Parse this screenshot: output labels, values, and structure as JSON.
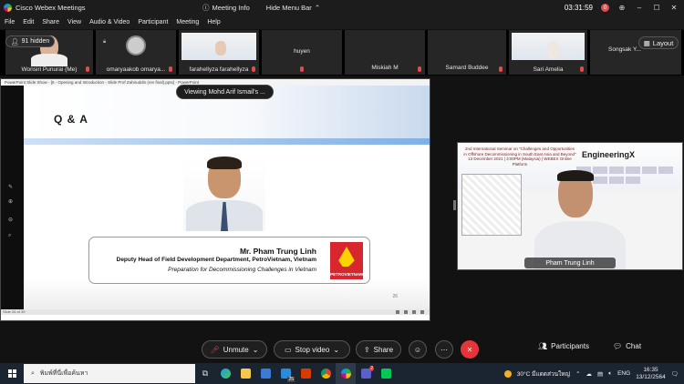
{
  "app": {
    "title": "Cisco Webex Meetings",
    "meeting_info": "Meeting Info",
    "hide_menu": "Hide Menu Bar",
    "timer": "03:31:59",
    "timer_badge": "0"
  },
  "menu": [
    "File",
    "Edit",
    "Share",
    "View",
    "Audio & Video",
    "Participant",
    "Meeting",
    "Help"
  ],
  "thumbnails": {
    "hidden_label": "91 hidden",
    "participants": [
      {
        "name": "Wonsiri Punurai (Me)"
      },
      {
        "name": "omaryaakob omarya..."
      },
      {
        "name": "farahellyza farahellyza"
      },
      {
        "name": "huyen"
      },
      {
        "name": "Miskiah M"
      },
      {
        "name": "Samard Buddee"
      },
      {
        "name": "Sari Amelia"
      },
      {
        "name": "Songsak Y..."
      }
    ],
    "layout_label": "Layout"
  },
  "share": {
    "viewing_label": "Viewing Mohd Arif Ismail's ...",
    "window_title": "PowerPoint Slide Show - [6 - Opening and Introduction - Slide Prof Zahiruddin (rev final).pptx] - PowerPoint",
    "slide": {
      "title": "Q & A",
      "speaker_name": "Mr. Pham Trung Linh",
      "role": "Deputy Head of Field Development Department, PetroVietnam, Vietnam",
      "topic": "Preparation for Decommissioning Challenges in Vietnam",
      "logo_text": "PETROVIETNAM",
      "page": "26"
    },
    "status_text": "Slide 26 of 39"
  },
  "speaker": {
    "name": "Pham Trung Linh",
    "banner_text": "2nd International Seminar on \"Challenges and Opportunities in Offshore Decommissioning in South East Asia and Beyond\" 13 December 2021 | 3:00PM (Malaysia) | WEBEX Online Platform",
    "banner_brand": "EngineeringX"
  },
  "controls": {
    "unmute": "Unmute",
    "stop_video": "Stop video",
    "share": "Share",
    "participants": "Participants",
    "chat": "Chat"
  },
  "taskbar": {
    "search_placeholder": "พิมพ์ที่นี่เพื่อค้นหา",
    "weather": "30°C มีแดดส่วนใหญ่",
    "lang": "ENG",
    "time": "16:35",
    "date": "13/12/2564",
    "notif_badge": "25",
    "teams_badge": "2"
  },
  "colors": {
    "accent": "#e3353a",
    "mic_off": "#e64b4b",
    "taskbar": "#1b2431"
  }
}
